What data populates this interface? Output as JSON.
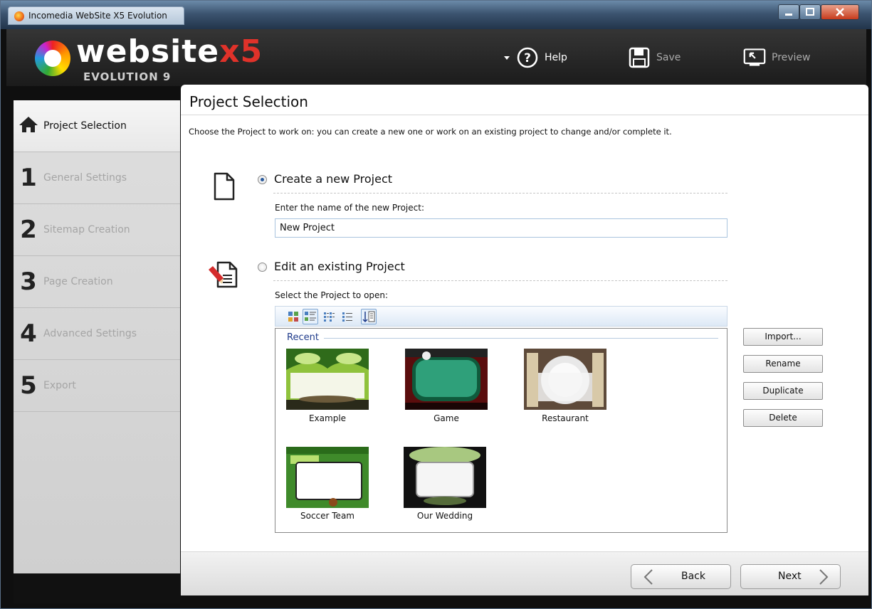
{
  "window": {
    "title": "Incomedia WebSite X5 Evolution"
  },
  "header": {
    "logo_word": "website",
    "logo_x5": "x5",
    "logo_sub": "EVOLUTION 9",
    "help_label": "Help",
    "save_label": "Save",
    "preview_label": "Preview"
  },
  "sidebar": {
    "items": [
      {
        "num": "",
        "label": "Project Selection"
      },
      {
        "num": "1",
        "label": "General Settings"
      },
      {
        "num": "2",
        "label": "Sitemap Creation"
      },
      {
        "num": "3",
        "label": "Page Creation"
      },
      {
        "num": "4",
        "label": "Advanced Settings"
      },
      {
        "num": "5",
        "label": "Export"
      }
    ]
  },
  "main": {
    "title": "Project Selection",
    "description": "Choose the Project to work on: you can create a new one or work on an existing project to change and/or complete it.",
    "create": {
      "label": "Create a new Project",
      "field_label": "Enter the name of the new Project:",
      "value": "New Project"
    },
    "edit": {
      "label": "Edit an existing Project",
      "field_label": "Select the Project to open:",
      "group_label": "Recent",
      "projects": [
        "Example",
        "Game",
        "Restaurant",
        "Soccer Team",
        "Our Wedding"
      ]
    },
    "actions": {
      "import": "Import...",
      "rename": "Rename",
      "duplicate": "Duplicate",
      "delete": "Delete"
    },
    "footer": {
      "back": "Back",
      "next": "Next"
    }
  }
}
